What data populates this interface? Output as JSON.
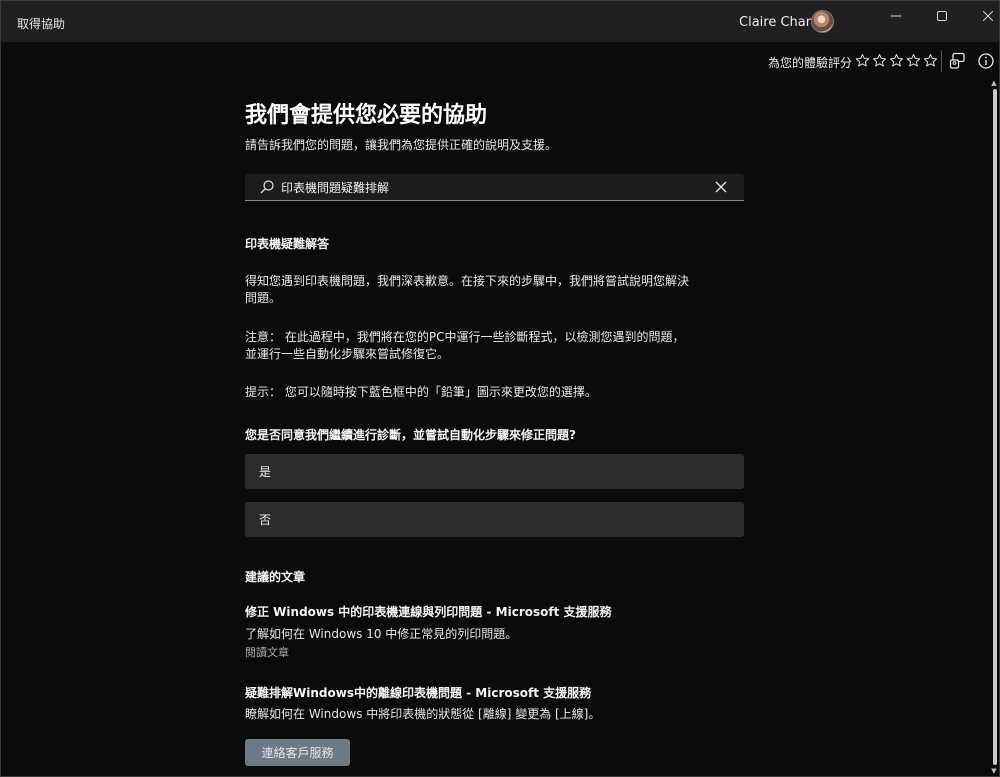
{
  "window": {
    "title": "取得協助",
    "user_name": "Claire Chang"
  },
  "toolbar": {
    "rating_label": "為您的體驗評分",
    "stars": 5,
    "rating_value": 0
  },
  "main": {
    "headline": "我們會提供您必要的協助",
    "subline": "請告訴我們您的問題，讓我們為您提供正確的說明及支援。",
    "search": {
      "value": "印表機問題疑難排解",
      "placeholder": ""
    },
    "troubleshooter": {
      "title": "印表機疑難解答",
      "intro": "得知您遇到印表機問題，我們深表歉意。在接下來的步驟中，我們將嘗試說明您解決問題。",
      "note_label": "注意：",
      "note_text": "在此過程中，我們將在您的PC中運行一些診斷程式，以檢測您遇到的問題，並運行一些自動化步驟來嘗試修復它。",
      "tip_label": "提示：",
      "tip_text": "您可以隨時按下藍色框中的「鉛筆」圖示來更改您的選擇。",
      "question": "您是否同意我們繼續進行診斷，並嘗試自動化步驟來修正問題?",
      "choices": [
        "是",
        "否"
      ]
    },
    "articles": {
      "heading": "建議的文章",
      "items": [
        {
          "title": "修正 Windows 中的印表機連線與列印問題 - Microsoft 支援服務",
          "desc": "了解如何在 Windows 10 中修正常見的列印問題。",
          "link": "閱讀文章"
        },
        {
          "title": "疑難排解Windows中的離線印表機問題 - Microsoft 支援服務",
          "desc": "瞭解如何在 Windows 中將印表機的狀態從 [離線] 變更為 [上線]。"
        }
      ]
    },
    "contact_button": "連絡客戶服務"
  }
}
